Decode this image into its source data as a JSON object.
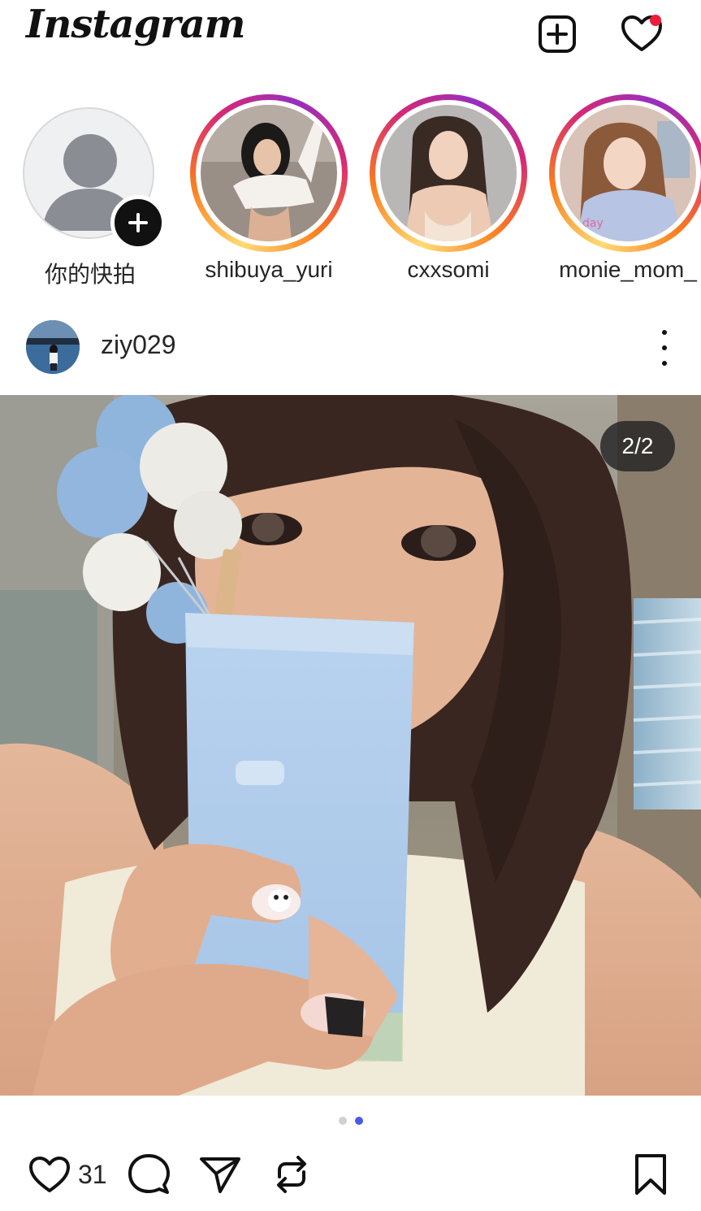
{
  "header": {
    "logo": "Instagram",
    "new_post_icon": "plus-square-icon",
    "notifications_icon": "heart-icon",
    "notification_dot_color": "#ee1d3a"
  },
  "stories": [
    {
      "label": "你的快拍",
      "own": true
    },
    {
      "label": "shibuya_yuri"
    },
    {
      "label": "cxxsomi"
    },
    {
      "label": "monie_mom_"
    }
  ],
  "post": {
    "username": "ziy029",
    "image_counter": "2/2",
    "carousel": {
      "total": 2,
      "active": 2
    },
    "likes": "31"
  },
  "actions": {
    "like_icon": "heart-outline-icon",
    "comment_icon": "comment-bubble-icon",
    "share_icon": "send-icon",
    "repost_icon": "repost-icon",
    "save_icon": "bookmark-icon"
  },
  "colors": {
    "story_ring": [
      "#feda75",
      "#fa7e1e",
      "#d62976",
      "#962fbf"
    ],
    "active_dot": "#4a5ae8"
  }
}
